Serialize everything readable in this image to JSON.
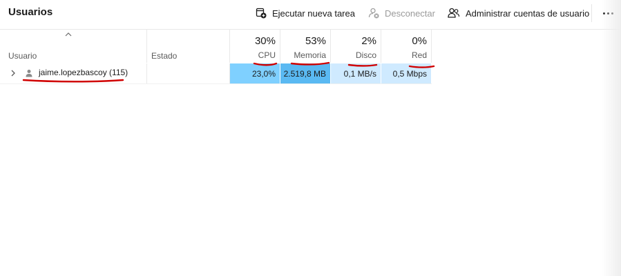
{
  "header": {
    "title": "Usuarios",
    "run_task_label": "Ejecutar nueva tarea",
    "disconnect_label": "Desconectar",
    "manage_accounts_label": "Administrar cuentas de usuario"
  },
  "columns": {
    "user": "Usuario",
    "status": "Estado",
    "cpu": {
      "percent": "30%",
      "label": "CPU"
    },
    "memory": {
      "percent": "53%",
      "label": "Memoria"
    },
    "disk": {
      "percent": "2%",
      "label": "Disco"
    },
    "network": {
      "percent": "0%",
      "label": "Red"
    }
  },
  "rows": [
    {
      "user": "jaime.lopezbascoy (115)",
      "status": "",
      "cpu": "23,0%",
      "memory": "2.519,8 MB",
      "disk": "0,1 MB/s",
      "network": "0,5 Mbps"
    }
  ],
  "colors": {
    "cpu_cell": "#7fd0ff",
    "memory_cell": "#5ab9f2",
    "light_cell": "#cfeaff",
    "annotation_red": "#d00000"
  },
  "icons": [
    "run-task-icon",
    "disconnect-icon",
    "manage-accounts-icon",
    "more-options-icon",
    "sort-up-icon",
    "expand-chevron-icon",
    "user-icon"
  ]
}
